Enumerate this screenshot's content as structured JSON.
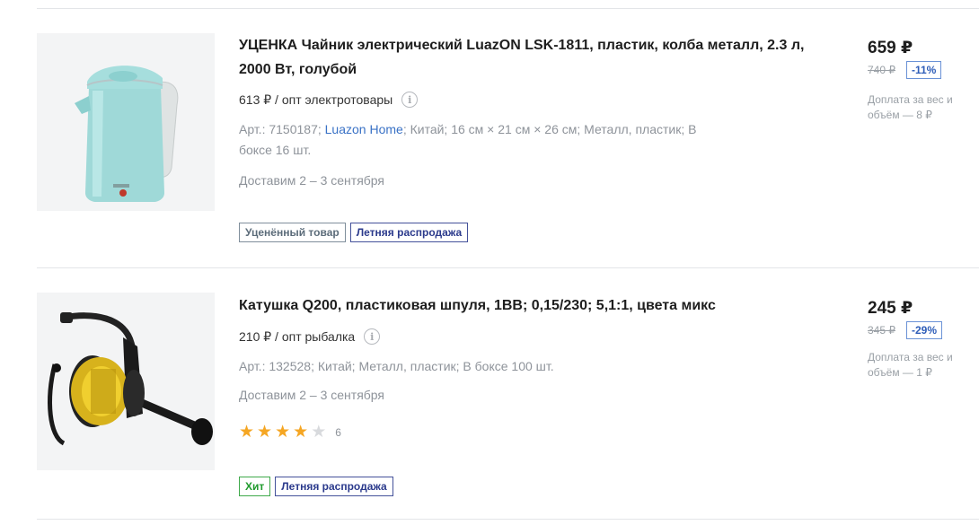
{
  "products": [
    {
      "title": "УЦЕНКА Чайник электрический LuazON LSK-1811, пластик, колба металл, 2.3 л, 2000 Вт, голубой",
      "wholesale": "613 ₽ / опт электротовары",
      "meta_prefix": "Арт.: 7150187;",
      "brand_link": "Luazon Home",
      "meta_suffix": "; Китай; 16 см × 21 см × 26 см; Металл, пластик; В боксе 16 шт.",
      "delivery": "Доставим 2 – 3 сентября",
      "price": "659 ₽",
      "old_price": "740 ₽",
      "discount": "-11%",
      "surcharge": "Доплата за вес и объём — 8 ₽",
      "badges": [
        "Уценённый товар",
        "Летняя распродажа"
      ],
      "image_icon": "kettle-icon"
    },
    {
      "title": "Катушка Q200, пластиковая шпуля, 1ВВ; 0,15/230; 5,1:1, цвета микс",
      "wholesale": "210 ₽ / опт рыбалка",
      "meta": "Арт.: 132528; Китай; Металл, пластик; В боксе 100 шт.",
      "delivery": "Доставим 2 – 3 сентября",
      "price": "245 ₽",
      "old_price": "345 ₽",
      "discount": "-29%",
      "surcharge": "Доплата за вес и объём — 1 ₽",
      "rating": 4,
      "rating_max": 5,
      "reviews": "6",
      "badges": [
        "Хит",
        "Летняя распродажа"
      ],
      "image_icon": "fishing-reel-icon"
    }
  ],
  "info_symbol": "i",
  "star_symbol": "★",
  "colors": {
    "star": "#f5a623",
    "link": "#3a72c6",
    "discount": "#2e5db8",
    "badge_hit": "#1f9a2c",
    "badge_sale": "#2b3a8c"
  }
}
